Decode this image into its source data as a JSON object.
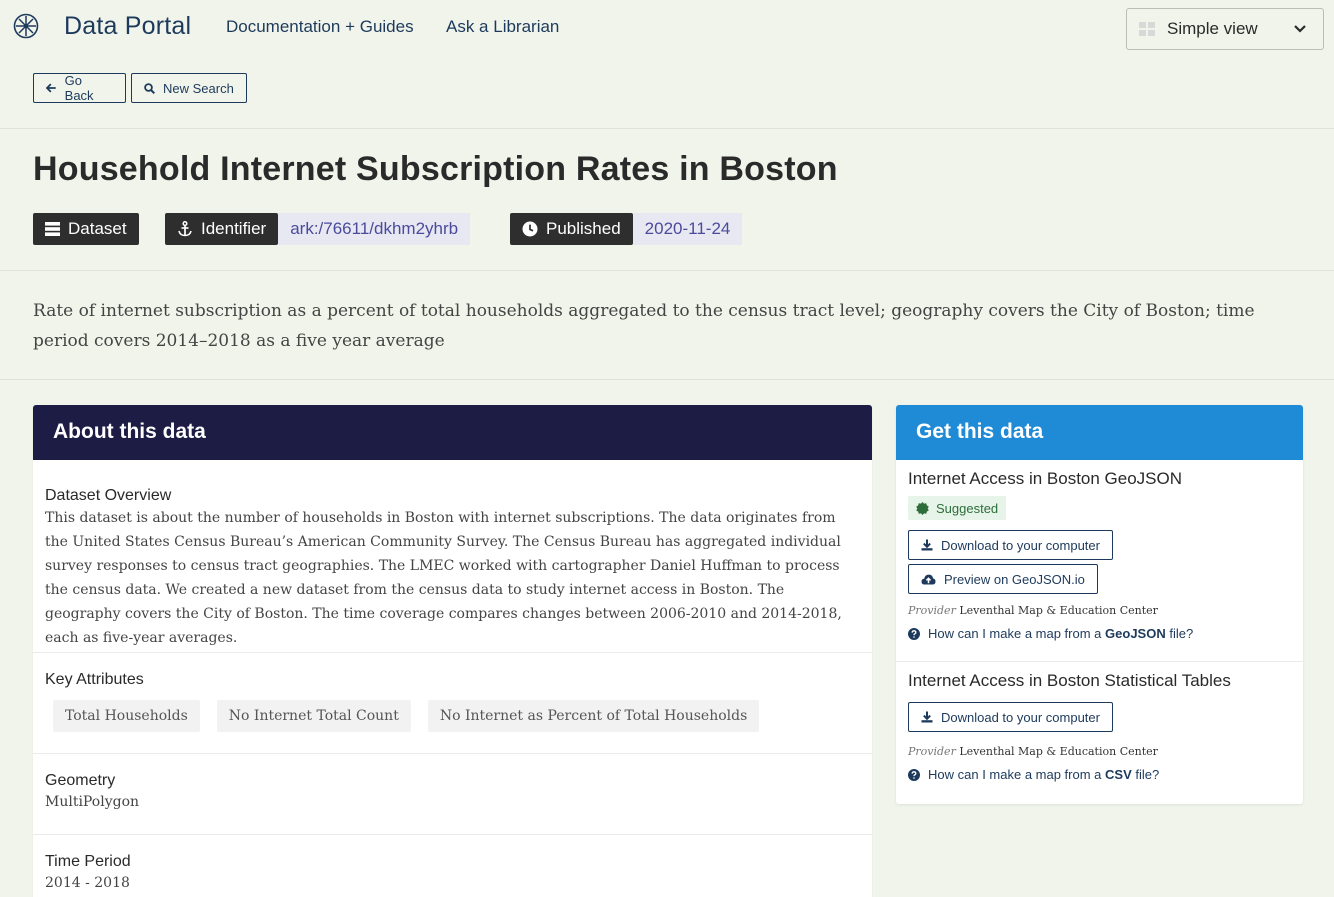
{
  "nav": {
    "brand": "Data Portal",
    "links": [
      "Documentation + Guides",
      "Ask a Librarian"
    ],
    "view_select": "Simple view"
  },
  "toolbar": {
    "go_back": "Go Back",
    "new_search": "New Search"
  },
  "record": {
    "title": "Household Internet Subscription Rates in Boston",
    "type": "Dataset",
    "identifier_label": "Identifier",
    "identifier_value": "ark:/76611/dkhm2yhrb",
    "published_label": "Published",
    "published_value": "2020-11-24",
    "description": "Rate of internet subscription as a percent of total households aggregated to the census tract level; geography covers the City of Boston; time period covers 2014–2018 as a five year average"
  },
  "about": {
    "heading": "About this data",
    "overview_title": "Dataset Overview",
    "overview_body": "This dataset is about the number of households in Boston with internet subscriptions. The data originates from the United States Census Bureau’s American Community Survey. The Census Bureau has aggregated individual survey responses to census tract geographies. The LMEC worked with cartographer Daniel Huffman to process the census data. We created a new dataset from the census data to study internet access in Boston. The geography covers the City of Boston. The time coverage compares changes between 2006-2010 and 2014-2018, each as five-year averages.",
    "attributes_title": "Key Attributes",
    "attributes": [
      "Total Households",
      "No Internet Total Count",
      "No Internet as Percent of Total Households"
    ],
    "geometry_title": "Geometry",
    "geometry_value": "MultiPolygon",
    "time_title": "Time Period",
    "time_value": "2014 - 2018"
  },
  "get": {
    "heading": "Get this data",
    "resources": [
      {
        "title": "Internet Access in Boston GeoJSON",
        "badge": "Suggested",
        "download": "Download to your computer",
        "preview": "Preview on GeoJSON.io",
        "provider_label": "Provider",
        "provider": "Leventhal Map & Education Center",
        "help_prefix": "How can I make a map from a",
        "help_format": "GeoJSON",
        "help_suffix": "file?"
      },
      {
        "title": "Internet Access in Boston Statistical Tables",
        "download": "Download to your computer",
        "provider_label": "Provider",
        "provider": "Leventhal Map & Education Center",
        "help_prefix": "How can I make a map from a",
        "help_format": "CSV",
        "help_suffix": "file?"
      }
    ]
  },
  "icons": [
    "compass-logo-icon",
    "grid-icon",
    "chevron-down-icon",
    "arrow-left-icon",
    "search-icon",
    "database-icon",
    "anchor-icon",
    "clock-icon",
    "badge-check-icon",
    "download-icon",
    "cloud-upload-icon",
    "question-circle-icon"
  ],
  "colors": {
    "navy": "#1d3a5c",
    "about_header": "#1c1c44",
    "get_header": "#1f8bd6",
    "accent_text": "#4b4b9c",
    "background": "#f1f4ea"
  }
}
